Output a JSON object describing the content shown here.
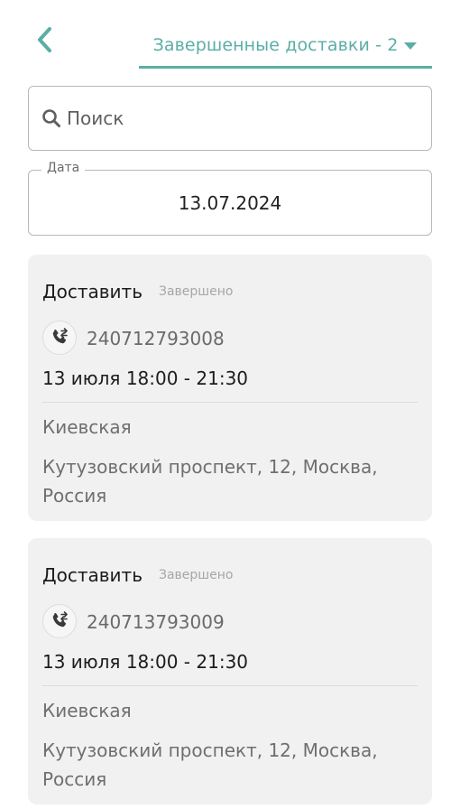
{
  "header": {
    "back_icon": "chevron-left-icon",
    "tab_label": "Завершенные доставки - 2",
    "dropdown_icon": "caret-down-icon",
    "accent_color": "#5aaea6"
  },
  "search": {
    "placeholder": "Поиск",
    "icon": "search-icon"
  },
  "date_filter": {
    "label": "Дата",
    "value": "13.07.2024"
  },
  "orders": [
    {
      "title": "Доставить",
      "status": "Завершено",
      "phone_icon": "phone-transfer-icon",
      "number": "240712793008",
      "time": "13 июля 18:00 - 21:30",
      "metro": "Киевская",
      "address": "Кутузовский проспект, 12, Москва, Рос­сия"
    },
    {
      "title": "Доставить",
      "status": "Завершено",
      "phone_icon": "phone-transfer-icon",
      "number": "240713793009",
      "time": "13 июля 18:00 - 21:30",
      "metro": "Киевская",
      "address": "Кутузовский проспект, 12, Москва, Рос­сия"
    }
  ]
}
